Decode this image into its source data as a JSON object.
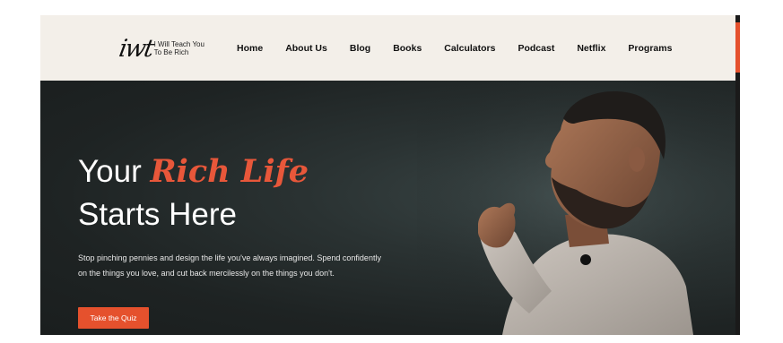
{
  "header": {
    "logo": {
      "mark": "iwt",
      "text": "I Will Teach You To Be Rich"
    },
    "nav": [
      "Home",
      "About Us",
      "Blog",
      "Books",
      "Calculators",
      "Podcast",
      "Netflix",
      "Programs"
    ]
  },
  "hero": {
    "title_line1_plain": "Your ",
    "title_line1_accent": "Rich Life",
    "title_line2": "Starts Here",
    "subtitle": "Stop pinching pennies and design the life you've always imagined. Spend confidently on the things you love, and cut back mercilessly on the things you don't.",
    "cta_label": "Take the Quiz",
    "image_description": "speaker portrait"
  },
  "colors": {
    "accent": "#e5512d",
    "header_bg": "#f3efe9",
    "hero_bg": "#1e2323"
  }
}
